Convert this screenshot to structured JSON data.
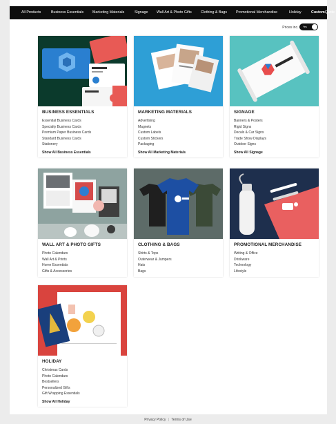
{
  "nav": {
    "items": [
      "All Products",
      "Business Essentials",
      "Marketing Materials",
      "Signage",
      "Wall Art & Photo Gifts",
      "Clothing & Bags",
      "Promotional Merchandise",
      "Holiday"
    ],
    "custom_strong": "Custom",
    "custom_rest": "Quote"
  },
  "prices": {
    "label": "Prices inc. GST",
    "toggle_text": "Yes"
  },
  "cards": [
    {
      "title": "Business Essentials",
      "links": [
        "Essential Business Cards",
        "Specialty Business Cards",
        "Premium Paper Business Cards",
        "Standard Business Cards",
        "Stationery"
      ],
      "show_all": "Show All Business Essentials"
    },
    {
      "title": "Marketing Materials",
      "links": [
        "Advertising",
        "Magnets",
        "Custom Labels",
        "Custom Stickers",
        "Packaging"
      ],
      "show_all": "Show All Marketing Materials"
    },
    {
      "title": "Signage",
      "links": [
        "Banners & Posters",
        "Rigid Signs",
        "Decals & Car Signs",
        "Trade Show Displays",
        "Outdoor Signs"
      ],
      "show_all": "Show All Signage"
    },
    {
      "title": "Wall Art & Photo Gifts",
      "links": [
        "Photo Calendars",
        "Wall Art & Prints",
        "Home Essentials",
        "Gifts & Accessories"
      ],
      "show_all": ""
    },
    {
      "title": "Clothing & Bags",
      "links": [
        "Shirts & Tops",
        "Outerwear & Jumpers",
        "Hats",
        "Bags"
      ],
      "show_all": ""
    },
    {
      "title": "Promotional Merchandise",
      "links": [
        "Writing & Office",
        "Drinkware",
        "Technology",
        "Lifestyle"
      ],
      "show_all": ""
    },
    {
      "title": "Holiday",
      "links": [
        "Christmas Cards",
        "Photo Calendars",
        "Bestsellers",
        "Personalized Gifts",
        "Gift Wrapping Essentials"
      ],
      "show_all": "Show All Holiday"
    }
  ],
  "footer": {
    "privacy": "Privacy Policy",
    "sep": "|",
    "terms": "Terms of Use"
  },
  "colors": {
    "nav_bg": "#0e0e0e",
    "page_bg": "#ececec",
    "card_bg": "#ffffff"
  }
}
